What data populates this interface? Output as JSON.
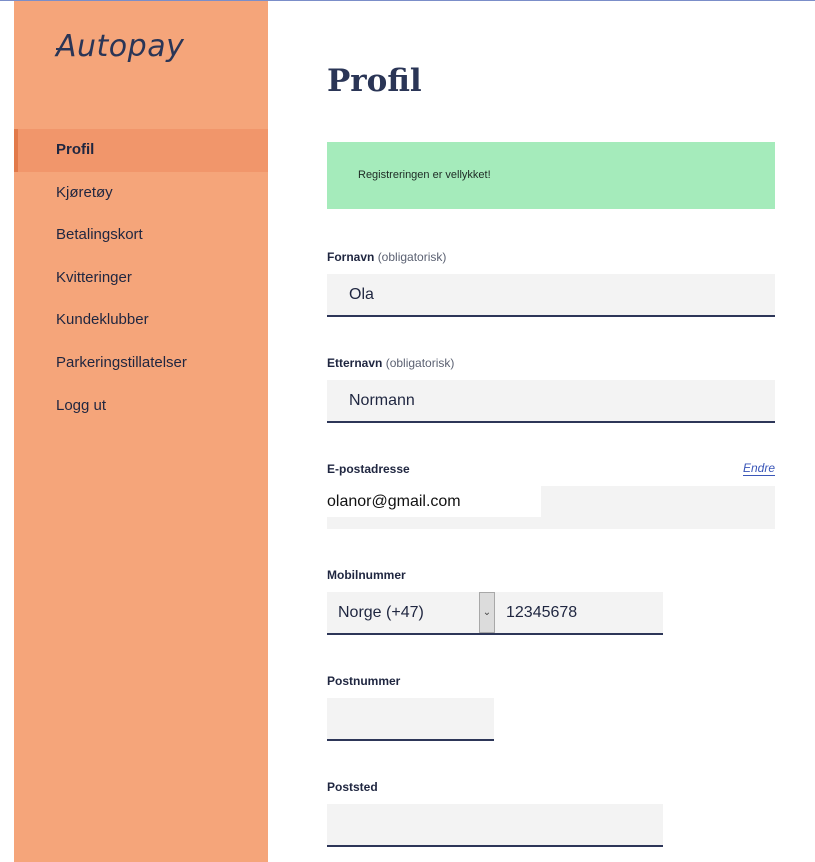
{
  "sidebar": {
    "logo": "Autopay",
    "items": [
      {
        "label": "Profil"
      },
      {
        "label": "Kjøretøy"
      },
      {
        "label": "Betalingskort"
      },
      {
        "label": "Kvitteringer"
      },
      {
        "label": "Kundeklubber"
      },
      {
        "label": "Parkeringstillatelser"
      },
      {
        "label": "Logg ut"
      }
    ]
  },
  "main": {
    "title": "Profil",
    "alert": "Registreringen er vellykket!",
    "fornavn": {
      "label": "Fornavn",
      "note": "(obligatorisk)",
      "value": "Ola"
    },
    "etternavn": {
      "label": "Etternavn",
      "note": "(obligatorisk)",
      "value": "Normann"
    },
    "email": {
      "label": "E-postadresse",
      "edit_link": "Endre",
      "value": "olanor@gmail.com"
    },
    "mobil": {
      "label": "Mobilnummer",
      "country": "Norge (+47)",
      "value": "12345678"
    },
    "postnummer": {
      "label": "Postnummer",
      "value": ""
    },
    "poststed": {
      "label": "Poststed",
      "value": ""
    }
  },
  "colors": {
    "sidebar_bg": "#f5a57a",
    "sidebar_active": "#f1966b",
    "alert_bg": "#a5ebbb",
    "field_bg": "#f3f3f3",
    "accent_dark": "#2a3556",
    "link": "#3a56b8"
  }
}
